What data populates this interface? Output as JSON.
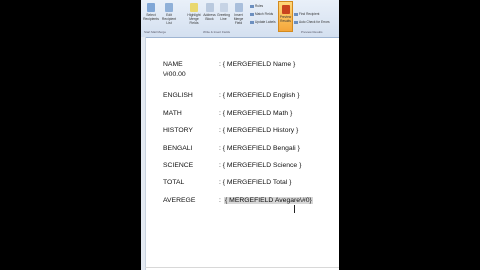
{
  "ribbon": {
    "buttons": [
      {
        "label": "Select Recipients"
      },
      {
        "label": "Edit Recipient List"
      },
      {
        "label": "Highlight Merge Fields"
      },
      {
        "label": "Address Block"
      },
      {
        "label": "Greeting Line"
      },
      {
        "label": "Insert Merge Field"
      }
    ],
    "side_items": [
      {
        "label": "Rules"
      },
      {
        "label": "Match Fields"
      },
      {
        "label": "Update Labels"
      }
    ],
    "preview_label": "Preview Results",
    "find_items": [
      {
        "label": "Find Recipient"
      },
      {
        "label": "Auto Check for Errors"
      }
    ],
    "group_labels": {
      "start": "Start Mail Merge",
      "write": "Write & Insert Fields",
      "preview": "Preview Results"
    }
  },
  "document": {
    "rows": [
      {
        "label": "NAME",
        "field": ": { MERGEFIELD Name }"
      },
      {
        "label": "\\#00.00",
        "field": ""
      },
      {
        "label": "ENGLISH",
        "field": ": { MERGEFIELD English }"
      },
      {
        "label": "MATH",
        "field": ": { MERGEFIELD Math }"
      },
      {
        "label": "HISTORY",
        "field": ": { MERGEFIELD History }"
      },
      {
        "label": "BENGALI",
        "field": ": { MERGEFIELD Bengali }"
      },
      {
        "label": "SCIENCE",
        "field": ": { MERGEFIELD Science }"
      },
      {
        "label": "TOTAL",
        "field": ": { MERGEFIELD Total }"
      },
      {
        "label": "AVEREGE",
        "field_prefix": ":",
        "field": "{ MERGEFIELD Avegare\\#0}"
      }
    ]
  }
}
